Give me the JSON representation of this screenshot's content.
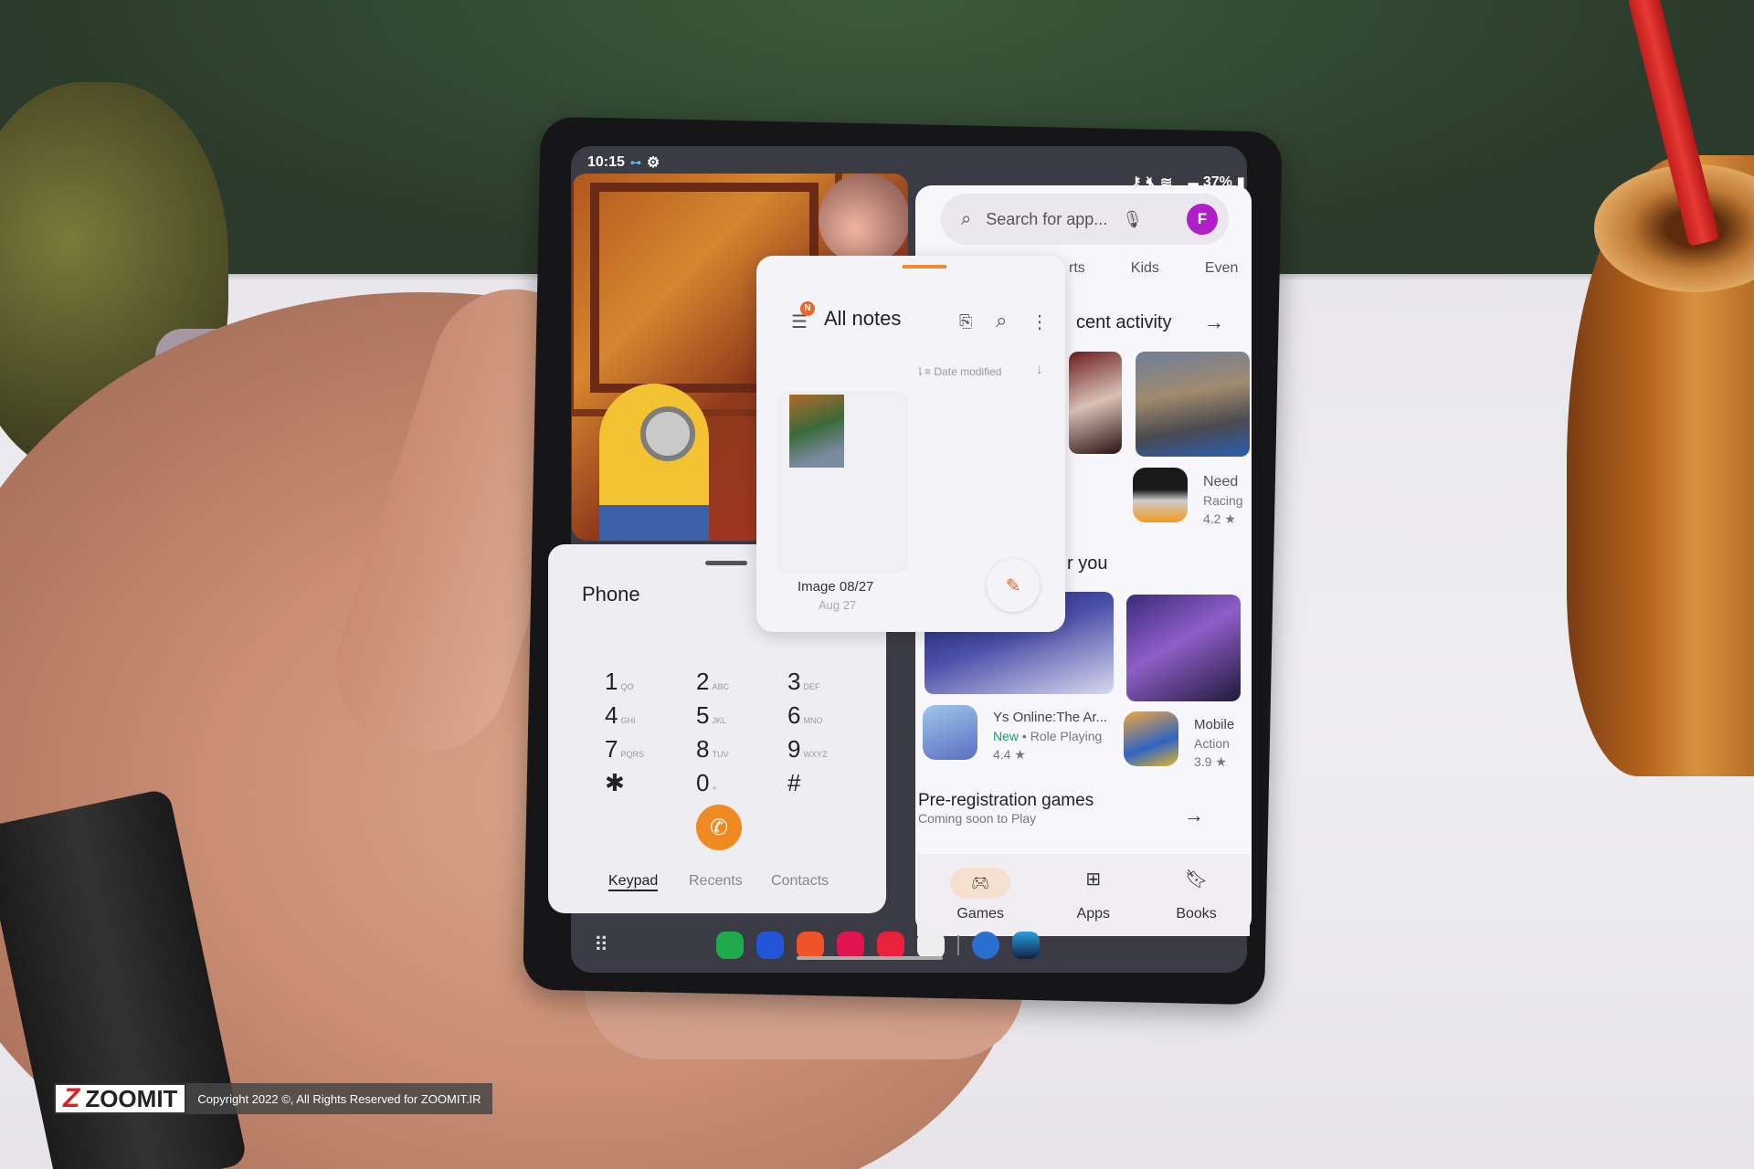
{
  "status_bar": {
    "time": "10:15",
    "battery": "37%",
    "icons": [
      "vpn-key-icon",
      "settings-icon",
      "key-icon",
      "mute-icon",
      "wifi-icon",
      "signal-icon",
      "battery-icon"
    ]
  },
  "play_store": {
    "search_placeholder": "Search for app...",
    "avatar_letter": "F",
    "tabs": [
      "rts",
      "Kids",
      "Even"
    ],
    "recent_activity": "cent activity",
    "need_for_speed": {
      "name": "Need",
      "genre": "Racing",
      "rating": "4.2 ★"
    },
    "for_you": "r you",
    "ys_online": {
      "name": "Ys Online:The Ar...",
      "badge": "New",
      "genre": "Role Playing",
      "rating": "4.4 ★"
    },
    "mobile": {
      "name": "Mobile",
      "genre": "Action",
      "rating": "3.9 ★"
    },
    "pre_registration": {
      "title": "Pre-registration games",
      "subtitle": "Coming soon to Play"
    },
    "nav": [
      "Games",
      "Apps",
      "Books"
    ],
    "accent": "#b01ec7"
  },
  "notes": {
    "badge": "N",
    "title": "All notes",
    "sort": "Date modified",
    "note_title": "Image 08/27",
    "note_date": "Aug 27",
    "accent": "#f0642a"
  },
  "phone": {
    "title": "Phone",
    "keys": [
      {
        "d": "1",
        "l": "QO"
      },
      {
        "d": "2",
        "l": "ABC"
      },
      {
        "d": "3",
        "l": "DEF"
      },
      {
        "d": "4",
        "l": "GHI"
      },
      {
        "d": "5",
        "l": "JKL"
      },
      {
        "d": "6",
        "l": "MNO"
      },
      {
        "d": "7",
        "l": "PQRS"
      },
      {
        "d": "8",
        "l": "TUV"
      },
      {
        "d": "9",
        "l": "WXYZ"
      },
      {
        "d": "✱",
        "l": ""
      },
      {
        "d": "0",
        "l": "+"
      },
      {
        "d": "#",
        "l": ""
      }
    ],
    "tabs": [
      "Keypad",
      "Recents",
      "Contacts"
    ],
    "call_color": "#ef8a20"
  },
  "dock": {
    "icons": [
      "apps-grid-icon",
      "phone-icon",
      "messages-icon",
      "notes-icon",
      "bixby-flower-icon",
      "screen-recorder-icon",
      "game-launcher-icon",
      "settings-icon",
      "game-icon"
    ]
  },
  "watermark": {
    "logo": "ZOOMIT",
    "copyright": "Copyright 2022 ©, All Rights Reserved for ZOOMIT.IR"
  }
}
